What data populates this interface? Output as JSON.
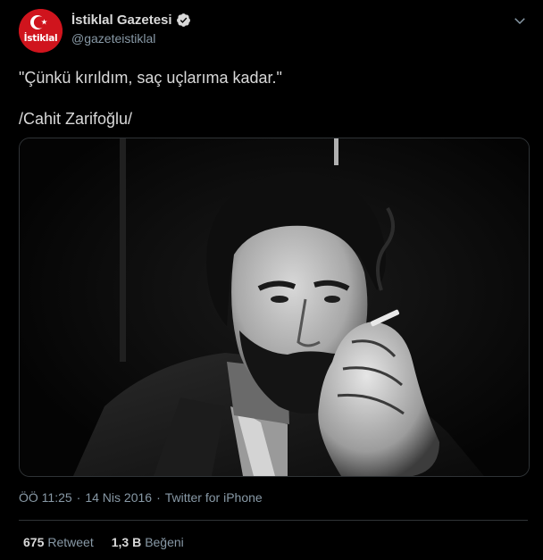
{
  "account": {
    "display_name": "İstiklal Gazetesi",
    "handle": "@gazeteistiklal",
    "avatar_text": "İstiklal",
    "verified_icon": "verified-badge-icon",
    "brand_color": "#d0141d",
    "verified_color": "#d9d9d9"
  },
  "tweet": {
    "line1": "\"Çünkü kırıldım, saç uçlarıma kadar.\"",
    "line2": "/Cahit Zarifoğlu/",
    "media_icon": "black-and-white-portrait-photo"
  },
  "meta": {
    "time": "ÖÖ 11:25",
    "separator": "·",
    "date": "14 Nis 2016",
    "source": "Twitter for iPhone"
  },
  "stats": {
    "retweet_count": "675",
    "retweet_label": "Retweet",
    "like_count": "1,3 B",
    "like_label": "Beğeni"
  },
  "colors": {
    "background": "#000000",
    "text": "#d9d9d9",
    "muted": "#8899a6",
    "border": "#2f3336"
  }
}
